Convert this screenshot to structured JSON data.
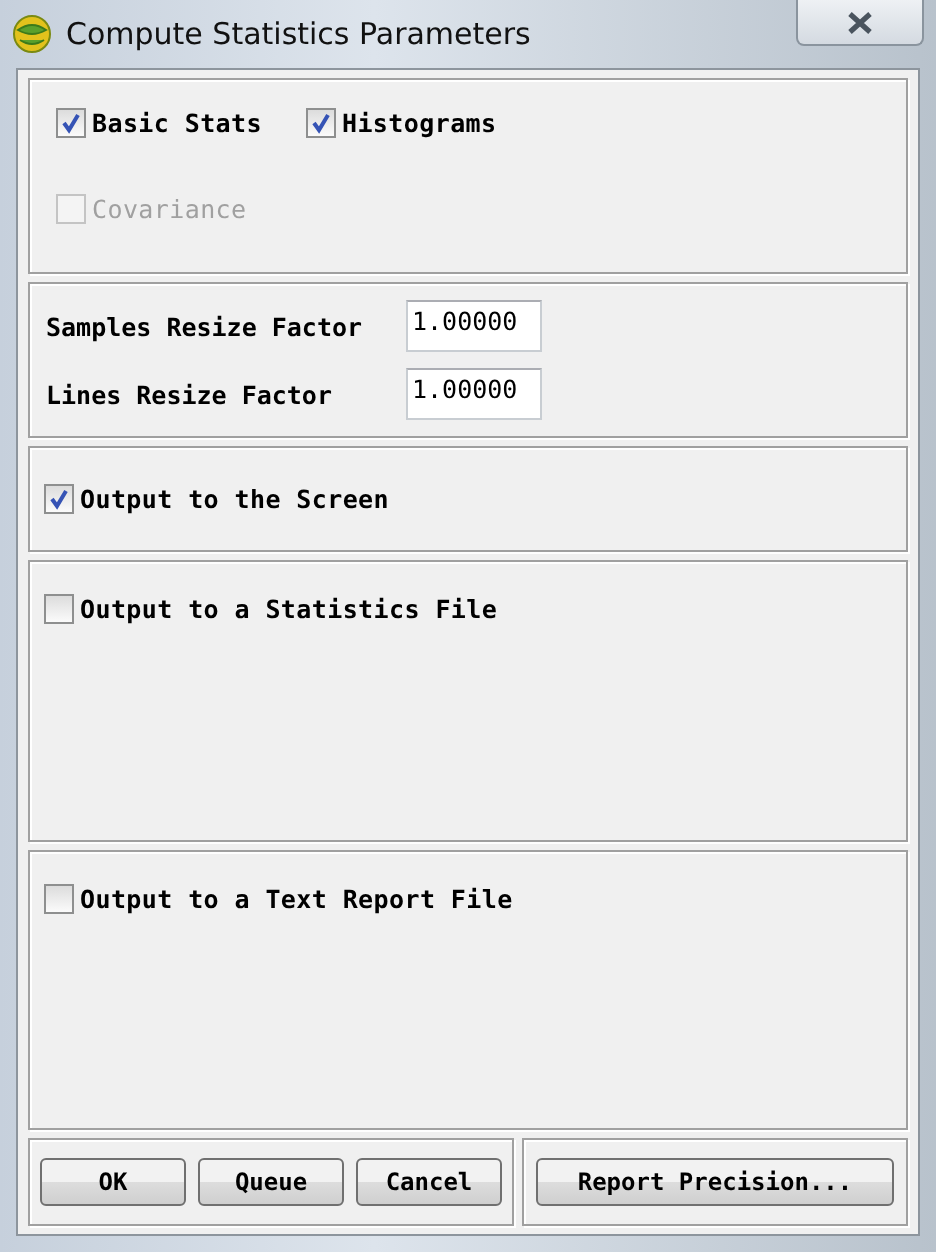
{
  "window": {
    "title": "Compute Statistics Parameters"
  },
  "statistics": [
    {
      "label": "Basic Stats",
      "checked": true,
      "disabled": false
    },
    {
      "label": "Histograms",
      "checked": true,
      "disabled": false
    },
    {
      "label": "Covariance",
      "checked": false,
      "disabled": true
    }
  ],
  "resize_factors": [
    {
      "label": "Samples Resize Factor",
      "value": "1.00000"
    },
    {
      "label": "Lines Resize Factor",
      "value": "1.00000"
    }
  ],
  "outputs": [
    {
      "label": "Output to the Screen",
      "checked": true
    },
    {
      "label": "Output to a Statistics File",
      "checked": false
    },
    {
      "label": "Output to a Text Report File",
      "checked": false
    }
  ],
  "buttons": [
    "OK",
    "Queue",
    "Cancel"
  ],
  "precision_button": "Report Precision..."
}
